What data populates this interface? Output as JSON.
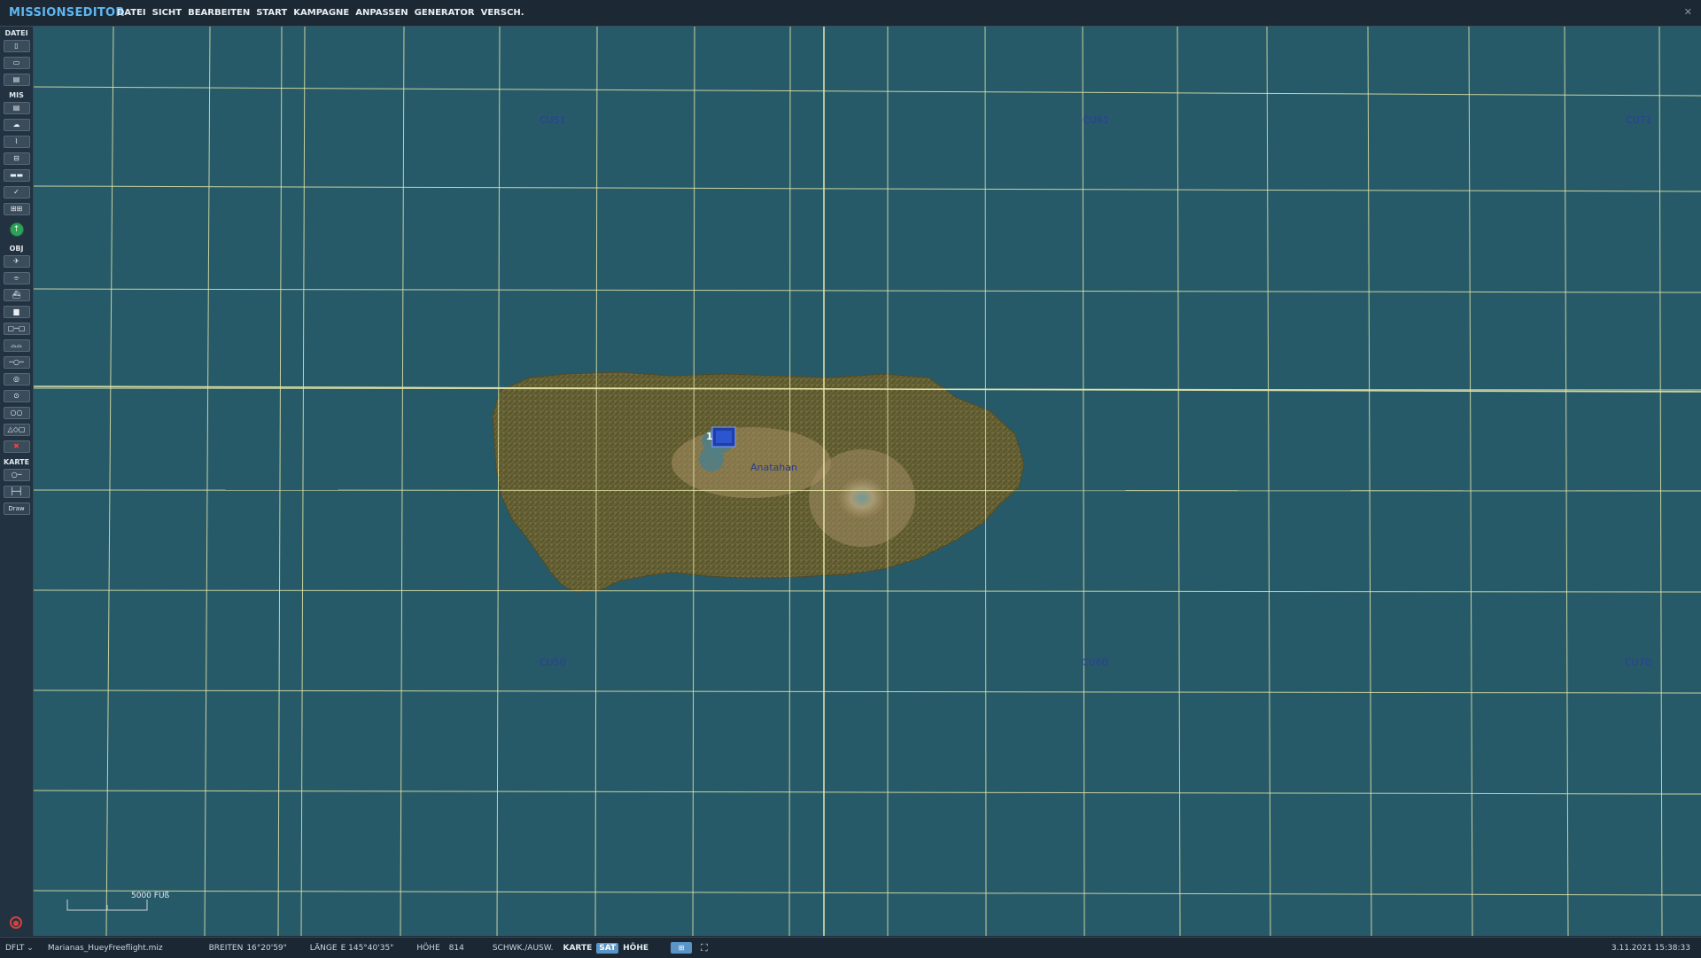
{
  "app": {
    "title": "MISSIONSEDITOR",
    "close_icon": "close-icon"
  },
  "menu": [
    "DATEI",
    "SICHT",
    "BEARBEITEN",
    "START",
    "KAMPAGNE",
    "ANPASSEN",
    "GENERATOR",
    "VERSCH."
  ],
  "toolbar": {
    "sections": {
      "datei": "DATEI",
      "mis": "MIS",
      "obj": "OBJ",
      "karte": "KARTE"
    },
    "draw_label": "Draw"
  },
  "map": {
    "grid_labels": {
      "cu51": "CU51",
      "cu61": "CU61",
      "cu71": "CU71",
      "cu50": "CU50",
      "cu60": "CU60",
      "cu70": "CU70"
    },
    "island_name": "Anatahan",
    "unit_number": "1",
    "scale_label": "5000 FUß",
    "colors": {
      "sea": "#275a69",
      "grid": "#e4e6a8",
      "land": "#5b5a2e",
      "crater": "#9a8a66"
    }
  },
  "status": {
    "profile": "DFLT",
    "filename": "Marianas_HueyFreeflight.miz",
    "lat_label": "BREITEN",
    "lat_value": "16°20'59\"",
    "lon_label": "LÄNGE",
    "lon_value": "E 145°40'35\"",
    "alt_label": "HÖHE",
    "alt_value": "814",
    "mode_label": "SCHWK./AUSW.",
    "view_karte": "KARTE",
    "view_sat": "SAT",
    "view_hoehe": "HÖHE",
    "datetime": "3.11.2021 15:38:33"
  }
}
